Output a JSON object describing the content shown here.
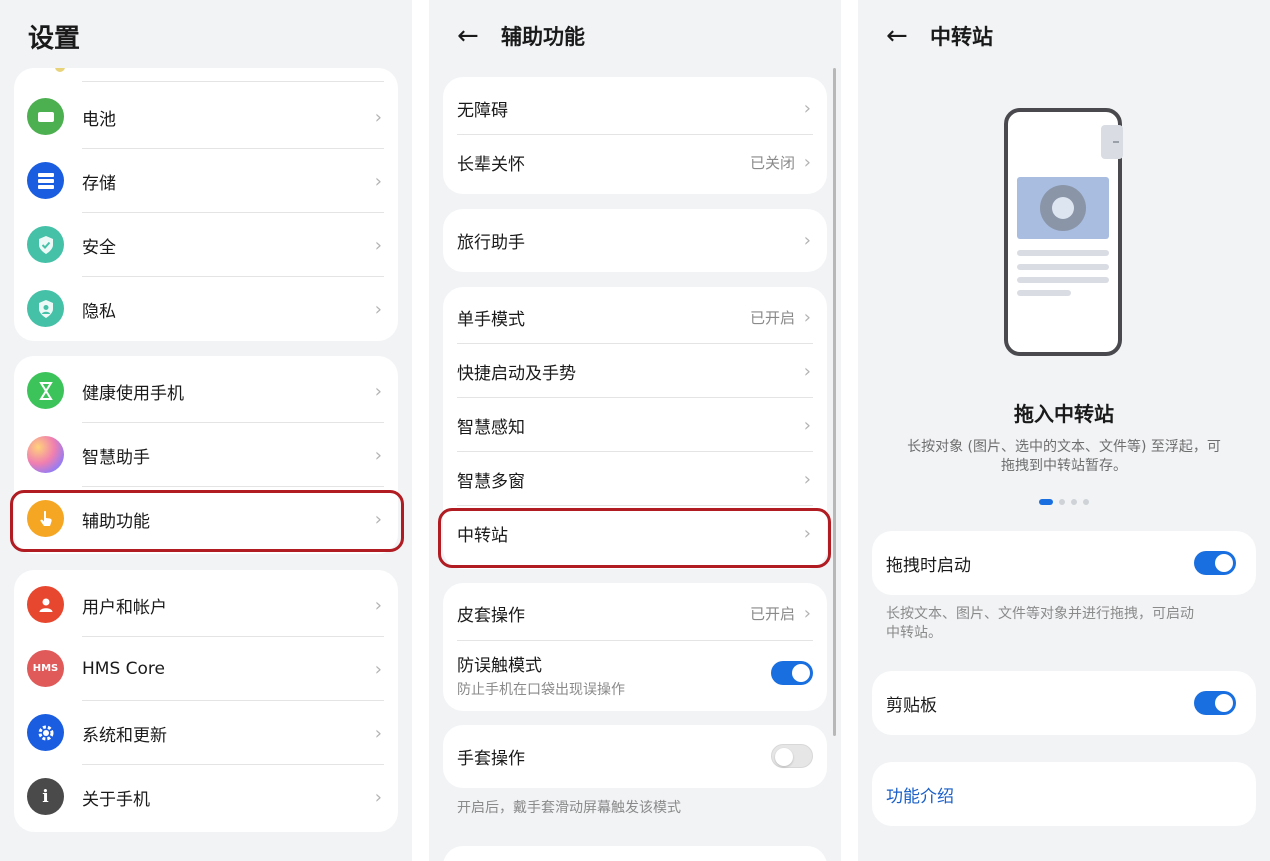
{
  "settings": {
    "title": "设置",
    "group1": [
      {
        "label": "电池",
        "icon": "battery-icon",
        "color": "#4caf50"
      },
      {
        "label": "存储",
        "icon": "storage-icon",
        "color": "#1a5de0"
      },
      {
        "label": "安全",
        "icon": "shield-icon",
        "color": "#45c1a8"
      },
      {
        "label": "隐私",
        "icon": "privacy-icon",
        "color": "#45c1a8"
      }
    ],
    "group2": [
      {
        "label": "健康使用手机",
        "icon": "hourglass-icon",
        "color": "#3cc45a"
      },
      {
        "label": "智慧助手",
        "icon": "assistant-icon",
        "color": "#c78cd6"
      },
      {
        "label": "辅助功能",
        "icon": "hand-icon",
        "color": "#f5a623"
      }
    ],
    "group3": [
      {
        "label": "用户和帐户",
        "icon": "user-icon",
        "color": "#e8472f"
      },
      {
        "label": "HMS Core",
        "icon": "hms-icon",
        "color": "#e05a5a",
        "icon_text": "HMS"
      },
      {
        "label": "系统和更新",
        "icon": "gear-icon",
        "color": "#1a5de0"
      },
      {
        "label": "关于手机",
        "icon": "info-icon",
        "color": "#4a4a4a"
      }
    ]
  },
  "accessibility": {
    "title": "辅助功能",
    "card1": [
      {
        "label": "无障碍",
        "value": ""
      },
      {
        "label": "长辈关怀",
        "value": "已关闭"
      }
    ],
    "card2": [
      {
        "label": "旅行助手",
        "value": ""
      }
    ],
    "card3": [
      {
        "label": "单手模式",
        "value": "已开启"
      },
      {
        "label": "快捷启动及手势",
        "value": ""
      },
      {
        "label": "智慧感知",
        "value": ""
      },
      {
        "label": "智慧多窗",
        "value": ""
      },
      {
        "label": "中转站",
        "value": ""
      }
    ],
    "card4": {
      "cover_label": "皮套操作",
      "cover_value": "已开启",
      "mistouch_label": "防误触模式",
      "mistouch_sub": "防止手机在口袋出现误操作",
      "mistouch_on": true
    },
    "glove": {
      "label": "手套操作",
      "on": false,
      "note": "开启后，戴手套滑动屏幕触发该模式"
    }
  },
  "transit": {
    "title": "中转站",
    "heading": "拖入中转站",
    "desc_line1": "长按对象 (图片、选中的文本、文件等) 至浮起，可",
    "desc_line2": "拖拽到中转站暂存。",
    "carousel_page": 1,
    "carousel_total": 4,
    "drag_label": "拖拽时启动",
    "drag_on": true,
    "drag_note_line1": "长按文本、图片、文件等对象并进行拖拽，可启动",
    "drag_note_line2": "中转站。",
    "clipboard_label": "剪贴板",
    "clipboard_on": true,
    "intro_link": "功能介绍"
  },
  "colors": {
    "accent": "#1a6fe0",
    "highlight": "#b01c22"
  }
}
